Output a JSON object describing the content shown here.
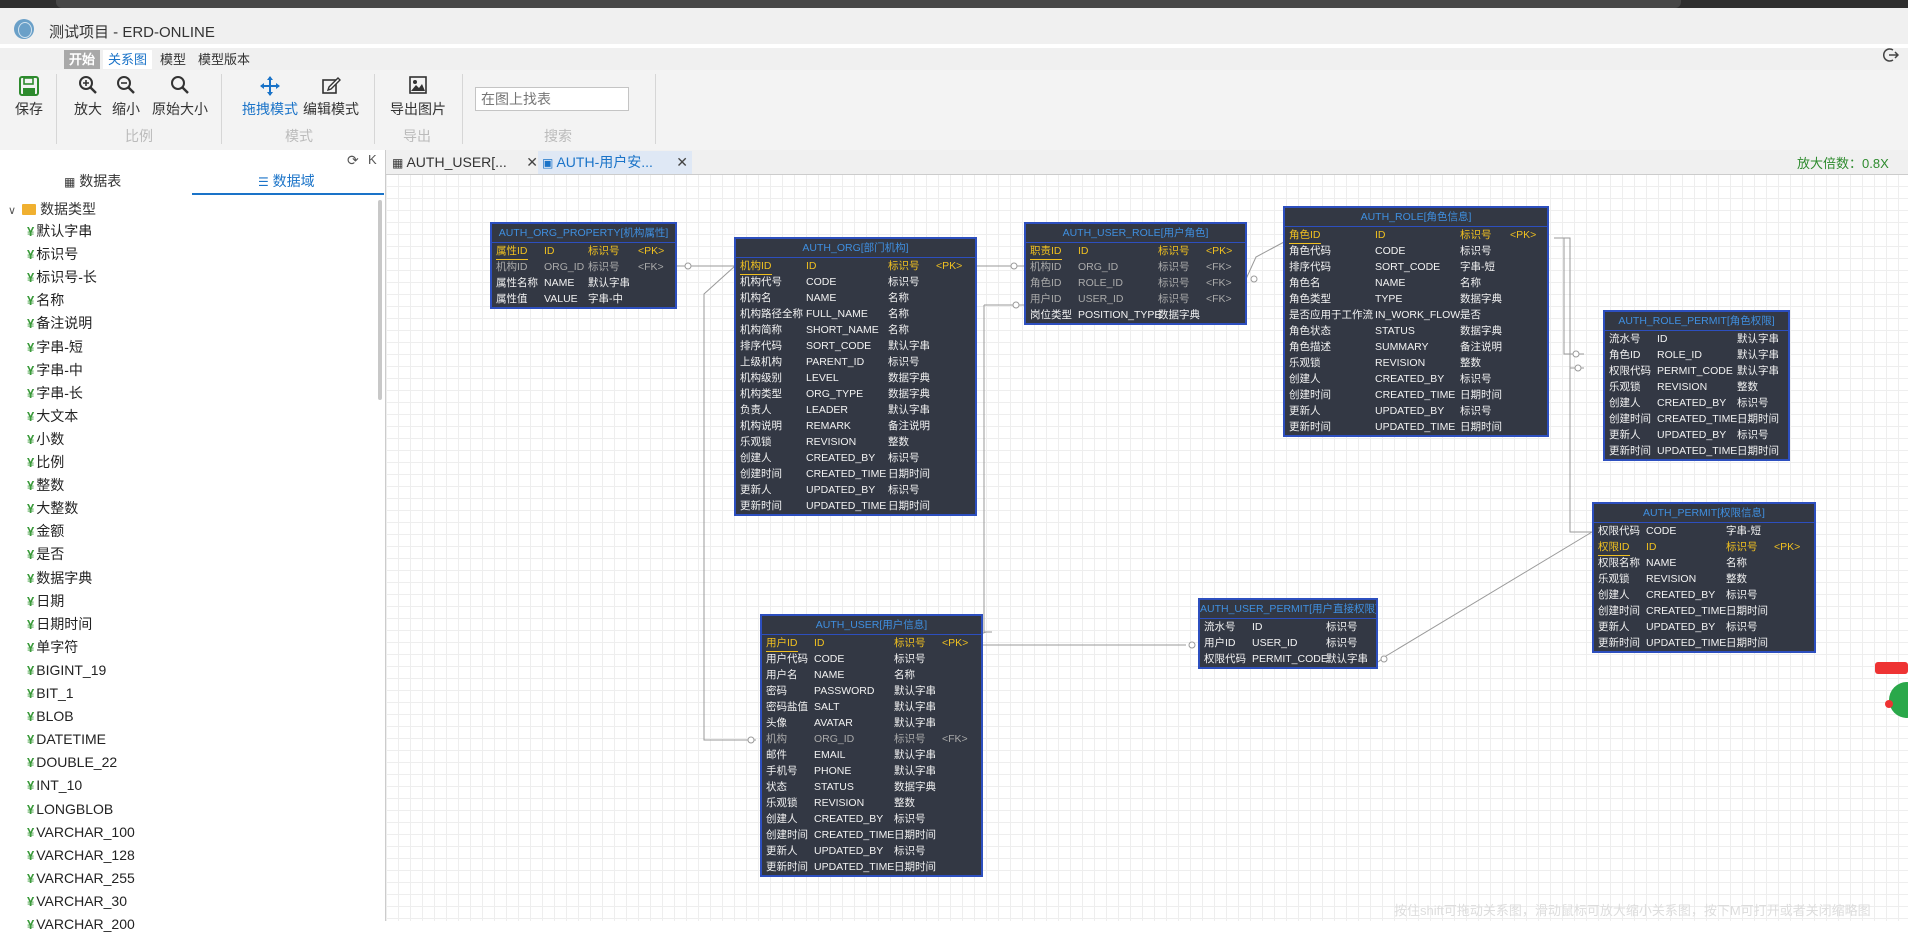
{
  "app": {
    "title": "测试项目 - ERD-ONLINE"
  },
  "menu": {
    "tabs": [
      "开始",
      "关系图",
      "模型",
      "模型版本"
    ]
  },
  "ribbon": {
    "save": "保存",
    "zoom_in": "放大",
    "zoom_out": "缩小",
    "original_size": "原始大小",
    "group_scale": "比例",
    "drag_mode": "拖拽模式",
    "edit_mode": "编辑模式",
    "group_mode": "模式",
    "export_image": "导出图片",
    "group_export": "导出",
    "search_placeholder": "在图上找表",
    "group_search": "搜索"
  },
  "sidebar": {
    "tab_tables": "数据表",
    "tab_domains": "数据域",
    "collapse": "K",
    "root": "数据类型",
    "items": [
      "默认字串",
      "标识号",
      "标识号-长",
      "名称",
      "备注说明",
      "字串-短",
      "字串-中",
      "字串-长",
      "大文本",
      "小数",
      "比例",
      "整数",
      "大整数",
      "金额",
      "是否",
      "数据字典",
      "日期",
      "日期时间",
      "单字符",
      "BIGINT_19",
      "BIT_1",
      "BLOB",
      "DATETIME",
      "DOUBLE_22",
      "INT_10",
      "LONGBLOB",
      "VARCHAR_100",
      "VARCHAR_128",
      "VARCHAR_255",
      "VARCHAR_30",
      "VARCHAR_200"
    ]
  },
  "canvas": {
    "tabs": [
      "AUTH_USER[...",
      "AUTH-用户安..."
    ],
    "zoom_text": "放大倍数：0.8X",
    "hint": "按住shift可拖动关系图，滑动鼠标可放大缩小关系图，按下M可打开或者关闭缩略图"
  },
  "entities": {
    "org_property": {
      "title": "AUTH_ORG_PROPERTY[机构属性]",
      "rows": [
        [
          "属性ID",
          "ID",
          "标识号",
          "<PK>"
        ],
        [
          "机构ID",
          "ORG_ID",
          "标识号",
          "<FK>"
        ],
        [
          "属性名称",
          "NAME",
          "默认字串",
          ""
        ],
        [
          "属性值",
          "VALUE",
          "字串-中",
          ""
        ]
      ]
    },
    "org": {
      "title": "AUTH_ORG[部门机构]",
      "rows": [
        [
          "机构ID",
          "ID",
          "标识号",
          "<PK>"
        ],
        [
          "机构代号",
          "CODE",
          "标识号",
          ""
        ],
        [
          "机构名",
          "NAME",
          "名称",
          ""
        ],
        [
          "机构路径全称",
          "FULL_NAME",
          "名称",
          ""
        ],
        [
          "机构简称",
          "SHORT_NAME",
          "名称",
          ""
        ],
        [
          "排序代码",
          "SORT_CODE",
          "默认字串",
          ""
        ],
        [
          "上级机构",
          "PARENT_ID",
          "标识号",
          ""
        ],
        [
          "机构级别",
          "LEVEL",
          "数据字典",
          ""
        ],
        [
          "机构类型",
          "ORG_TYPE",
          "数据字典",
          ""
        ],
        [
          "负责人",
          "LEADER",
          "默认字串",
          ""
        ],
        [
          "机构说明",
          "REMARK",
          "备注说明",
          ""
        ],
        [
          "乐观锁",
          "REVISION",
          "整数",
          ""
        ],
        [
          "创建人",
          "CREATED_BY",
          "标识号",
          ""
        ],
        [
          "创建时间",
          "CREATED_TIME",
          "日期时间",
          ""
        ],
        [
          "更新人",
          "UPDATED_BY",
          "标识号",
          ""
        ],
        [
          "更新时间",
          "UPDATED_TIME",
          "日期时间",
          ""
        ]
      ]
    },
    "user_role": {
      "title": "AUTH_USER_ROLE[用户角色]",
      "rows": [
        [
          "职责ID",
          "ID",
          "标识号",
          "<PK>"
        ],
        [
          "机构ID",
          "ORG_ID",
          "标识号",
          "<FK>"
        ],
        [
          "角色ID",
          "ROLE_ID",
          "标识号",
          "<FK>"
        ],
        [
          "用户ID",
          "USER_ID",
          "标识号",
          "<FK>"
        ],
        [
          "岗位类型",
          "POSITION_TYPE",
          "数据字典",
          ""
        ]
      ]
    },
    "role": {
      "title": "AUTH_ROLE[角色信息]",
      "rows": [
        [
          "角色ID",
          "ID",
          "标识号",
          "<PK>"
        ],
        [
          "角色代码",
          "CODE",
          "标识号",
          ""
        ],
        [
          "排序代码",
          "SORT_CODE",
          "字串-短",
          ""
        ],
        [
          "角色名",
          "NAME",
          "名称",
          ""
        ],
        [
          "角色类型",
          "TYPE",
          "数据字典",
          ""
        ],
        [
          "是否应用于工作流",
          "IN_WORK_FLOW",
          "是否",
          ""
        ],
        [
          "角色状态",
          "STATUS",
          "数据字典",
          ""
        ],
        [
          "角色描述",
          "SUMMARY",
          "备注说明",
          ""
        ],
        [
          "乐观锁",
          "REVISION",
          "整数",
          ""
        ],
        [
          "创建人",
          "CREATED_BY",
          "标识号",
          ""
        ],
        [
          "创建时间",
          "CREATED_TIME",
          "日期时间",
          ""
        ],
        [
          "更新人",
          "UPDATED_BY",
          "标识号",
          ""
        ],
        [
          "更新时间",
          "UPDATED_TIME",
          "日期时间",
          ""
        ]
      ]
    },
    "role_permit": {
      "title": "AUTH_ROLE_PERMIT[角色权限]",
      "rows": [
        [
          "流水号",
          "ID",
          "默认字串",
          ""
        ],
        [
          "角色ID",
          "ROLE_ID",
          "默认字串",
          ""
        ],
        [
          "权限代码",
          "PERMIT_CODE",
          "默认字串",
          ""
        ],
        [
          "乐观锁",
          "REVISION",
          "整数",
          ""
        ],
        [
          "创建人",
          "CREATED_BY",
          "标识号",
          ""
        ],
        [
          "创建时间",
          "CREATED_TIME",
          "日期时间",
          ""
        ],
        [
          "更新人",
          "UPDATED_BY",
          "标识号",
          ""
        ],
        [
          "更新时间",
          "UPDATED_TIME",
          "日期时间",
          ""
        ]
      ]
    },
    "permit": {
      "title": "AUTH_PERMIT[权限信息]",
      "rows": [
        [
          "权限代码",
          "CODE",
          "字串-短",
          ""
        ],
        [
          "权限ID",
          "ID",
          "标识号",
          "<PK>"
        ],
        [
          "权限名称",
          "NAME",
          "名称",
          ""
        ],
        [
          "乐观锁",
          "REVISION",
          "整数",
          ""
        ],
        [
          "创建人",
          "CREATED_BY",
          "标识号",
          ""
        ],
        [
          "创建时间",
          "CREATED_TIME",
          "日期时间",
          ""
        ],
        [
          "更新人",
          "UPDATED_BY",
          "标识号",
          ""
        ],
        [
          "更新时间",
          "UPDATED_TIME",
          "日期时间",
          ""
        ]
      ]
    },
    "user": {
      "title": "AUTH_USER[用户信息]",
      "rows": [
        [
          "用户ID",
          "ID",
          "标识号",
          "<PK>"
        ],
        [
          "用户代码",
          "CODE",
          "标识号",
          ""
        ],
        [
          "用户名",
          "NAME",
          "名称",
          ""
        ],
        [
          "密码",
          "PASSWORD",
          "默认字串",
          ""
        ],
        [
          "密码盐值",
          "SALT",
          "默认字串",
          ""
        ],
        [
          "头像",
          "AVATAR",
          "默认字串",
          ""
        ],
        [
          "机构",
          "ORG_ID",
          "标识号",
          "<FK>"
        ],
        [
          "邮件",
          "EMAIL",
          "默认字串",
          ""
        ],
        [
          "手机号",
          "PHONE",
          "默认字串",
          ""
        ],
        [
          "状态",
          "STATUS",
          "数据字典",
          ""
        ],
        [
          "乐观锁",
          "REVISION",
          "整数",
          ""
        ],
        [
          "创建人",
          "CREATED_BY",
          "标识号",
          ""
        ],
        [
          "创建时间",
          "CREATED_TIME",
          "日期时间",
          ""
        ],
        [
          "更新人",
          "UPDATED_BY",
          "标识号",
          ""
        ],
        [
          "更新时间",
          "UPDATED_TIME",
          "日期时间",
          ""
        ]
      ]
    },
    "user_permit": {
      "title": "AUTH_USER_PERMIT[用户直接权限]",
      "rows": [
        [
          "流水号",
          "ID",
          "标识号",
          ""
        ],
        [
          "用户ID",
          "USER_ID",
          "标识号",
          ""
        ],
        [
          "权限代码",
          "PERMIT_CODE",
          "默认字串",
          ""
        ]
      ]
    }
  }
}
